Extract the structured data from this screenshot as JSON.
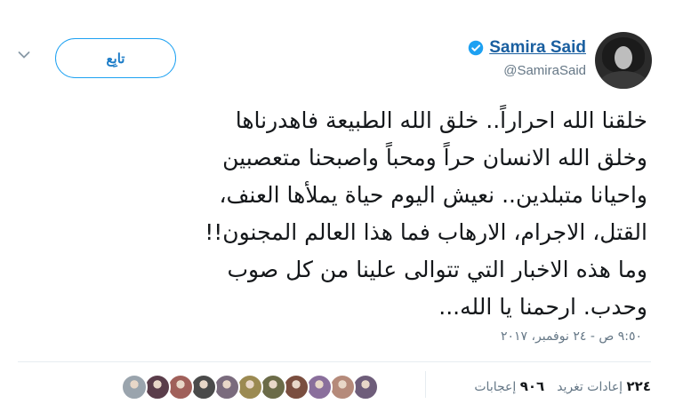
{
  "user": {
    "display_name": "Samira Said",
    "handle": "@SamiraSaid"
  },
  "follow_label": "تابِع",
  "tweet": {
    "text": "خلقنا الله احراراً.. خلق الله الطبيعة فاهدرناها\nوخلق الله الانسان حراً ومحباً واصبحنا متعصبين\nواحيانا متبلدين.. نعيش اليوم حياة يملأها العنف،\nالقتل، الاجرام، الارهاب فما هذا العالم المجنون!!\nوما هذه الاخبار التي تتوالى علينا من كل صوب\nوحدب. ارحمنا يا الله...",
    "timestamp": "٩:٥٠ ص - ٢٤ نوفمبر، ٢٠١٧"
  },
  "stats": {
    "retweets_count": "٢٢٤",
    "retweets_label": "إعادات تغريد",
    "likes_count": "٩٠٦",
    "likes_label": "إعجابات"
  },
  "colors": {
    "accent": "#1da1f2",
    "name": "#1a5fa0",
    "muted": "#657786"
  },
  "likers": [
    {
      "color": "#6e5d7a"
    },
    {
      "color": "#b58a7a"
    },
    {
      "color": "#8a6f9c"
    },
    {
      "color": "#7a4e3f"
    },
    {
      "color": "#6b6b48"
    },
    {
      "color": "#9b8a52"
    },
    {
      "color": "#7a6b7d"
    },
    {
      "color": "#4a4a4a"
    },
    {
      "color": "#a0605a"
    },
    {
      "color": "#5a3d4a"
    },
    {
      "color": "#9aa4ad"
    }
  ]
}
